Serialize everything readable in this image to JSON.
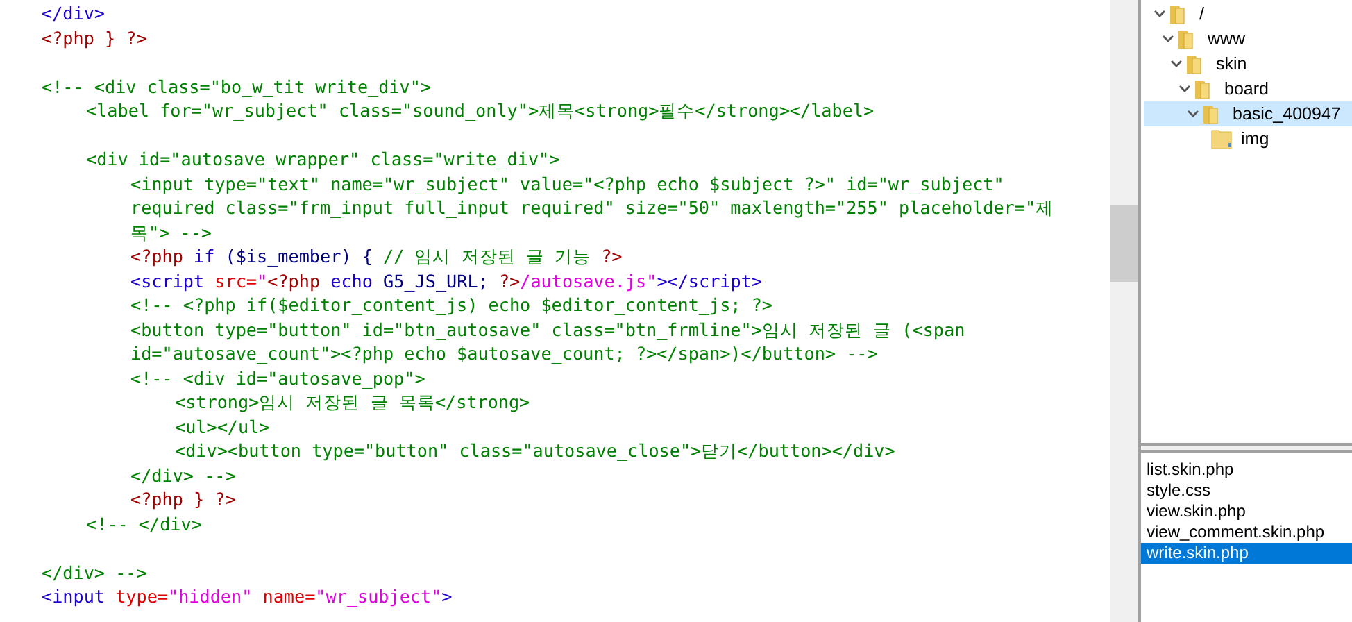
{
  "editor": {
    "lines": [
      {
        "segs": [
          {
            "kind": "tag",
            "text": "</div>"
          }
        ]
      },
      {
        "segs": [
          {
            "kind": "php",
            "text": "<?php } ?>"
          }
        ]
      },
      {
        "space_before": true,
        "segs": [
          {
            "kind": "comment",
            "text": "<!-- <div class=\"bo_w_tit write_div\">"
          }
        ],
        "children": [
          {
            "segs": [
              {
                "kind": "comment",
                "text": "<label for=\"wr_subject\" class=\"sound_only\">제목<strong>필수</strong></label>"
              }
            ]
          },
          {
            "space_before": true,
            "segs": [
              {
                "kind": "comment",
                "text": "<div id=\"autosave_wrapper\" class=\"write_div\">"
              }
            ],
            "children": [
              {
                "segs": [
                  {
                    "kind": "comment",
                    "text": "<input type=\"text\" name=\"wr_subject\" value=\"<?php echo $subject ?>\" id=\"wr_subject\""
                  }
                ]
              },
              {
                "segs": [
                  {
                    "kind": "comment",
                    "text": "required class=\"frm_input full_input required\" size=\"50\" maxlength=\"255\" placeholder=\"제"
                  }
                ]
              },
              {
                "segs": [
                  {
                    "kind": "comment",
                    "text": "목\"> -->"
                  }
                ]
              },
              {
                "segs": [
                  {
                    "kind": "php",
                    "text": "<?php "
                  },
                  {
                    "kind": "keyword",
                    "text": "if"
                  },
                  {
                    "kind": "var",
                    "text": " ($is_member) { "
                  },
                  {
                    "kind": "comment",
                    "text": "// 임시 저장된 글 기능 "
                  },
                  {
                    "kind": "php",
                    "text": "?>"
                  }
                ]
              },
              {
                "segs": [
                  {
                    "kind": "tag",
                    "text": "<script "
                  },
                  {
                    "kind": "attr",
                    "text": "src="
                  },
                  {
                    "kind": "string",
                    "text": "\""
                  },
                  {
                    "kind": "php",
                    "text": "<?php "
                  },
                  {
                    "kind": "keyword",
                    "text": "echo "
                  },
                  {
                    "kind": "var",
                    "text": "G5_JS_URL; "
                  },
                  {
                    "kind": "php",
                    "text": "?>"
                  },
                  {
                    "kind": "string",
                    "text": "/autosave.js\""
                  },
                  {
                    "kind": "tag",
                    "text": "></script>"
                  }
                ]
              },
              {
                "segs": [
                  {
                    "kind": "comment",
                    "text": "<!-- <?php if($editor_content_js) echo $editor_content_js; ?>"
                  }
                ]
              },
              {
                "segs": [
                  {
                    "kind": "comment",
                    "text": "<button type=\"button\" id=\"btn_autosave\" class=\"btn_frmline\">임시 저장된 글 (<span"
                  }
                ]
              },
              {
                "segs": [
                  {
                    "kind": "comment",
                    "text": "id=\"autosave_count\"><?php echo $autosave_count; ?></span>)</button> -->"
                  }
                ]
              },
              {
                "segs": [
                  {
                    "kind": "comment",
                    "text": "<!-- <div id=\"autosave_pop\">"
                  }
                ],
                "children": [
                  {
                    "segs": [
                      {
                        "kind": "comment",
                        "text": "<strong>임시 저장된 글 목록</strong>"
                      }
                    ]
                  },
                  {
                    "segs": [
                      {
                        "kind": "comment",
                        "text": "<ul></ul>"
                      }
                    ]
                  },
                  {
                    "segs": [
                      {
                        "kind": "comment",
                        "text": "<div><button type=\"button\" class=\"autosave_close\">닫기</button></div>"
                      }
                    ]
                  }
                ]
              },
              {
                "segs": [
                  {
                    "kind": "comment",
                    "text": "</div> -->"
                  }
                ]
              },
              {
                "segs": [
                  {
                    "kind": "php",
                    "text": "<?php } ?>"
                  }
                ]
              }
            ]
          },
          {
            "segs": [
              {
                "kind": "comment",
                "text": "<!-- </div>"
              }
            ]
          }
        ]
      },
      {
        "space_before": true,
        "segs": [
          {
            "kind": "comment",
            "text": "</div> -->"
          }
        ]
      },
      {
        "segs": [
          {
            "kind": "tag",
            "text": "<input "
          },
          {
            "kind": "attr",
            "text": "type="
          },
          {
            "kind": "string",
            "text": "\"hidden\" "
          },
          {
            "kind": "attr",
            "text": "name="
          },
          {
            "kind": "string",
            "text": "\"wr_subject\""
          },
          {
            "kind": "tag",
            "text": ">"
          }
        ]
      }
    ]
  },
  "folder_tree": [
    {
      "label": "/",
      "expanded": true,
      "selected": false,
      "children": [
        {
          "label": "www",
          "expanded": true,
          "selected": false,
          "children": [
            {
              "label": "skin",
              "expanded": true,
              "selected": false,
              "children": [
                {
                  "label": "board",
                  "expanded": true,
                  "selected": false,
                  "children": [
                    {
                      "label": "basic_400947",
                      "expanded": true,
                      "selected": true,
                      "children": [
                        {
                          "label": "img",
                          "selected": false
                        }
                      ]
                    }
                  ]
                }
              ]
            }
          ]
        }
      ]
    }
  ],
  "file_list": [
    {
      "label": "list.skin.php",
      "selected": false
    },
    {
      "label": "style.css",
      "selected": false
    },
    {
      "label": "view.skin.php",
      "selected": false
    },
    {
      "label": "view_comment.skin.php",
      "selected": false
    },
    {
      "label": "write.skin.php",
      "selected": true
    }
  ]
}
